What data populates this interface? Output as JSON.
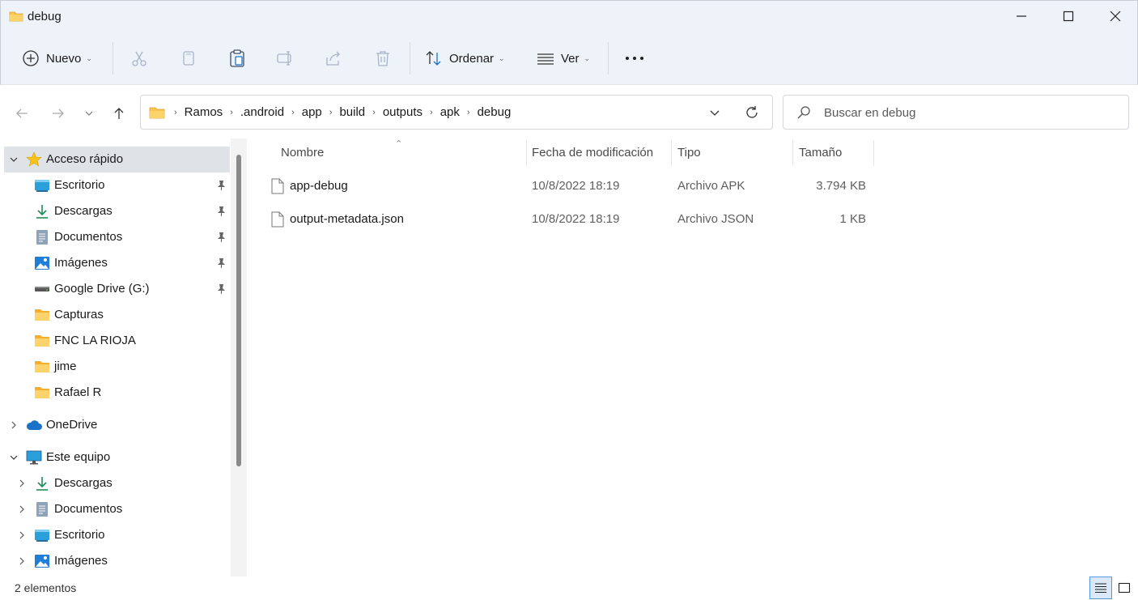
{
  "window": {
    "title": "debug",
    "controls": [
      "minimize",
      "maximize",
      "close"
    ]
  },
  "toolbar": {
    "new_label": "Nuevo",
    "sort_label": "Ordenar",
    "view_label": "Ver",
    "more_label": "•••"
  },
  "address": {
    "breadcrumbs": [
      "Ramos",
      ".android",
      "app",
      "build",
      "outputs",
      "apk",
      "debug"
    ]
  },
  "search": {
    "placeholder": "Buscar en debug"
  },
  "sidebar": {
    "quick_access": {
      "label": "Acceso rápido",
      "items": [
        {
          "label": "Escritorio",
          "icon": "desktop-icon",
          "pinned": true
        },
        {
          "label": "Descargas",
          "icon": "download-icon",
          "pinned": true
        },
        {
          "label": "Documentos",
          "icon": "documents-icon",
          "pinned": true
        },
        {
          "label": "Imágenes",
          "icon": "pictures-icon",
          "pinned": true
        },
        {
          "label": "Google Drive (G:)",
          "icon": "drive-icon",
          "pinned": true
        },
        {
          "label": "Capturas",
          "icon": "folder-icon",
          "pinned": false
        },
        {
          "label": "FNC LA RIOJA",
          "icon": "folder-icon",
          "pinned": false
        },
        {
          "label": "jime",
          "icon": "folder-icon",
          "pinned": false
        },
        {
          "label": "Rafael R",
          "icon": "folder-icon",
          "pinned": false
        }
      ]
    },
    "onedrive": {
      "label": "OneDrive"
    },
    "this_pc": {
      "label": "Este equipo",
      "items": [
        {
          "label": "Descargas",
          "icon": "download-icon"
        },
        {
          "label": "Documentos",
          "icon": "documents-icon"
        },
        {
          "label": "Escritorio",
          "icon": "desktop-icon"
        },
        {
          "label": "Imágenes",
          "icon": "pictures-icon"
        }
      ]
    }
  },
  "columns": {
    "name": "Nombre",
    "modified": "Fecha de modificación",
    "type": "Tipo",
    "size": "Tamaño"
  },
  "files": [
    {
      "name": "app-debug",
      "modified": "10/8/2022 18:19",
      "type": "Archivo APK",
      "size": "3.794 KB"
    },
    {
      "name": "output-metadata.json",
      "modified": "10/8/2022 18:19",
      "type": "Archivo JSON",
      "size": "1 KB"
    }
  ],
  "status": {
    "count_text": "2 elementos"
  },
  "colors": {
    "chrome_bg": "#eef2f9",
    "folder_yellow": "#f8c44f",
    "accent_blue": "#1a73c9",
    "selected_bg": "#dfe3e8"
  }
}
